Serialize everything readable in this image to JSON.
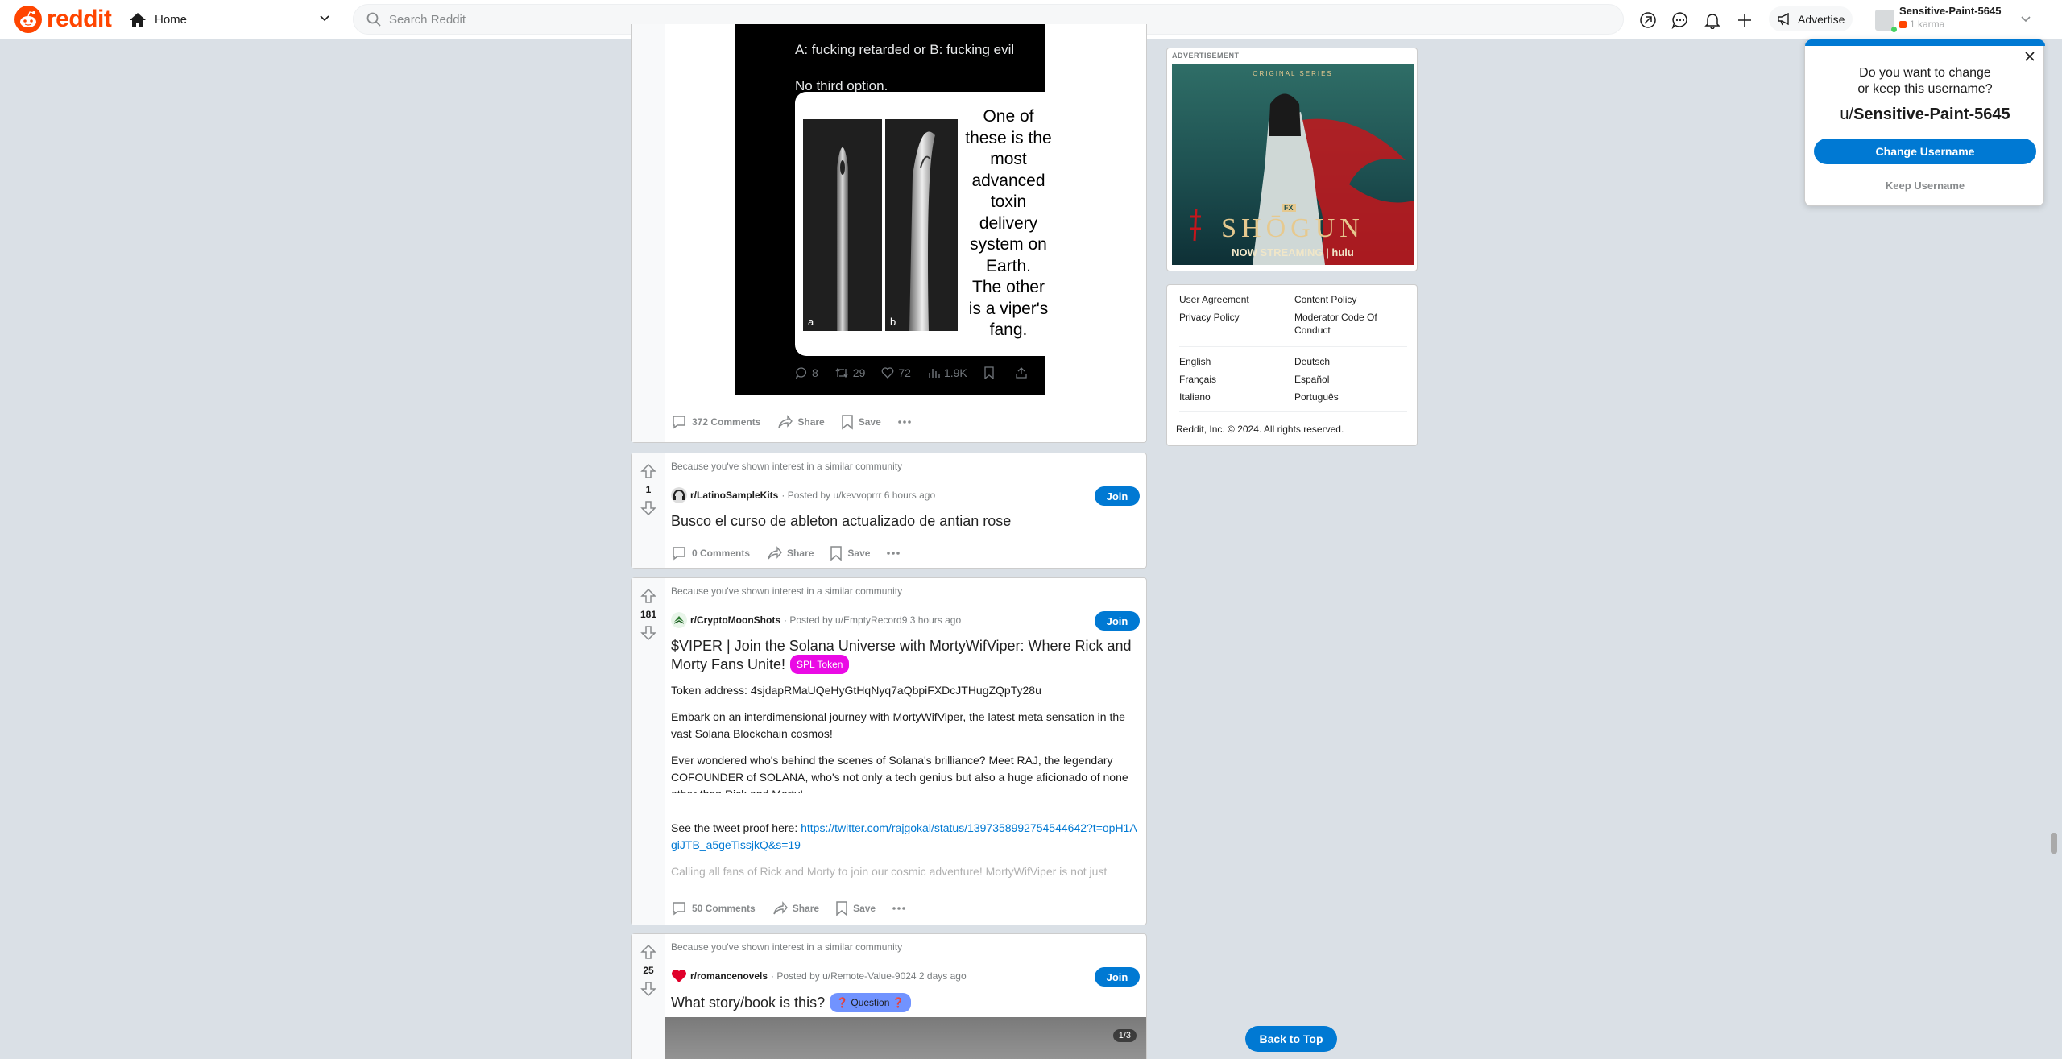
{
  "header": {
    "logo_text": "reddit",
    "home_label": "Home",
    "search_placeholder": "Search Reddit",
    "advertise_label": "Advertise",
    "username": "Sensitive-Paint-5645",
    "karma": "1 karma"
  },
  "tweet": {
    "line1": "A: fucking retarded or B: fucking evil",
    "line2": "No third option.",
    "quote_lines": [
      "One of",
      "these is the",
      "most",
      "advanced",
      "toxin",
      "delivery",
      "system on",
      "Earth.",
      "The other",
      "is a viper's",
      "fang."
    ],
    "image_labels": [
      "a",
      "b"
    ],
    "stats": {
      "replies": "8",
      "retweets": "29",
      "likes": "72",
      "views": "1.9K"
    }
  },
  "post0": {
    "comments": "372 Comments",
    "share": "Share",
    "save": "Save"
  },
  "posts": [
    {
      "reason": "Because you've shown interest in a similar community",
      "votes": "1",
      "subreddit": "r/LatinoSampleKits",
      "byline": "· Posted by u/kevvoprrr 6 hours ago",
      "join": "Join",
      "title": "Busco el curso de ableton actualizado de antian rose",
      "comments": "0 Comments",
      "share": "Share",
      "save": "Save"
    },
    {
      "reason": "Because you've shown interest in a similar community",
      "votes": "181",
      "subreddit": "r/CryptoMoonShots",
      "byline": "· Posted by u/EmptyRecord9 3 hours ago",
      "join": "Join",
      "title": "$VIPER | Join the Solana Universe with MortyWifViper: Where Rick and Morty Fans Unite!",
      "flair": "SPL Token",
      "body": {
        "p1": "Token address: 4sjdapRMaUQeHyGtHqNyq7aQbpiFXDcJTHugZQpTy28u",
        "p2": "Embark on an interdimensional journey with MortyWifViper, the latest meta sensation in the vast Solana Blockchain cosmos!",
        "p3": "Ever wondered who's behind the scenes of Solana's brilliance? Meet RAJ, the legendary COFOUNDER of SOLANA, who's not only a tech genius but also a huge aficionado of none other than Rick and Morty!",
        "p4_prefix": "See the tweet proof here: ",
        "p4_link": "https://twitter.com/rajgokal/status/1397358992754544642?t=opH1AgiJTB_a5geTissjkQ&s=19",
        "p5": "Calling all fans of Rick and Morty to join our cosmic adventure! MortyWifViper is not just"
      },
      "comments": "50 Comments",
      "share": "Share",
      "save": "Save"
    },
    {
      "reason": "Because you've shown interest in a similar community",
      "votes": "25",
      "subreddit": "r/romancenovels",
      "byline": "· Posted by u/Remote-Value-9024 2 days ago",
      "join": "Join",
      "title": "What story/book is this?",
      "flair": "❓ Question ❓",
      "gallery": "1/3"
    }
  ],
  "ad": {
    "label": "ADVERTISEMENT",
    "series": "ORIGINAL SERIES",
    "network": "FX",
    "title": "SHŌGUN",
    "streaming": "NOW STREAMING | hulu"
  },
  "footer_links": {
    "user_agreement": "User Agreement",
    "content_policy": "Content Policy",
    "privacy_policy": "Privacy Policy",
    "moderator_code": "Moderator Code Of Conduct",
    "english": "English",
    "deutsch": "Deutsch",
    "francais": "Français",
    "espanol": "Español",
    "italiano": "Italiano",
    "portugues": "Português",
    "copyright": "Reddit, Inc. © 2024. All rights reserved."
  },
  "popup": {
    "question": "Do you want to change or keep this username?",
    "prefix": "u/",
    "username": "Sensitive-Paint-5645",
    "change": "Change Username",
    "keep": "Keep Username"
  },
  "back_to_top": "Back to Top",
  "colors": {
    "brand": "#ff4500",
    "accent": "#0079d3",
    "spl_flair": "#ea0ae5",
    "question_flair": "#7193ff"
  }
}
